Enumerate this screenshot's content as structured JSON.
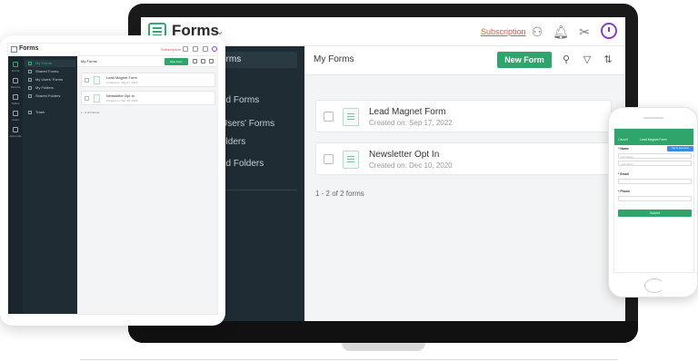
{
  "laptop": {
    "app_title": "Forms",
    "subscription_link": "Subscription",
    "sidebar": {
      "items": [
        "orms",
        "ed Forms",
        "Users' Forms",
        "olders",
        "ed Folders",
        "h"
      ]
    },
    "main": {
      "title": "My Forms",
      "new_form_label": "New Form",
      "forms": [
        {
          "title": "Lead Magnet Form",
          "created": "Created on: Sep 17, 2022"
        },
        {
          "title": "Newsletter Opt In",
          "created": "Created on: Dec 10, 2020"
        }
      ],
      "count_text": "1 - 2 of 2 forms"
    }
  },
  "tablet": {
    "app_title": "Forms",
    "subscription_link": "Subscription",
    "rail_labels": [
      "Forms",
      "Reports",
      "Tables",
      "Users",
      "Approvals"
    ],
    "sidebar_items": [
      "My Forms",
      "Shared Forms",
      "My Users' Forms",
      "My Folders",
      "Shared Folders",
      "Trash"
    ],
    "main": {
      "title": "My Forms",
      "new_form_label": "New Form",
      "forms": [
        {
          "title": "Lead Magnet Form",
          "created": "Created on: Sep 17, 2022"
        },
        {
          "title": "Newsletter Opt In",
          "created": "Created on: Dec 10, 2020"
        }
      ],
      "count_text": "1 - 2 of 2 forms"
    }
  },
  "phone": {
    "cancel": "Cancel",
    "form_title": "Lead Magnet Form",
    "tip": "Tap to save form",
    "fields": {
      "name_label": "* Name",
      "first_name_placeholder": "First Name",
      "last_name_placeholder": "Last Name",
      "email_label": "* Email",
      "phone_label": "* Phone"
    },
    "submit": "Submit"
  },
  "colors": {
    "accent_green": "#2fa56b",
    "sidebar_dark": "#1f2c33",
    "subscription_red": "#e2573d",
    "profile_purple": "#8a3cc9"
  }
}
